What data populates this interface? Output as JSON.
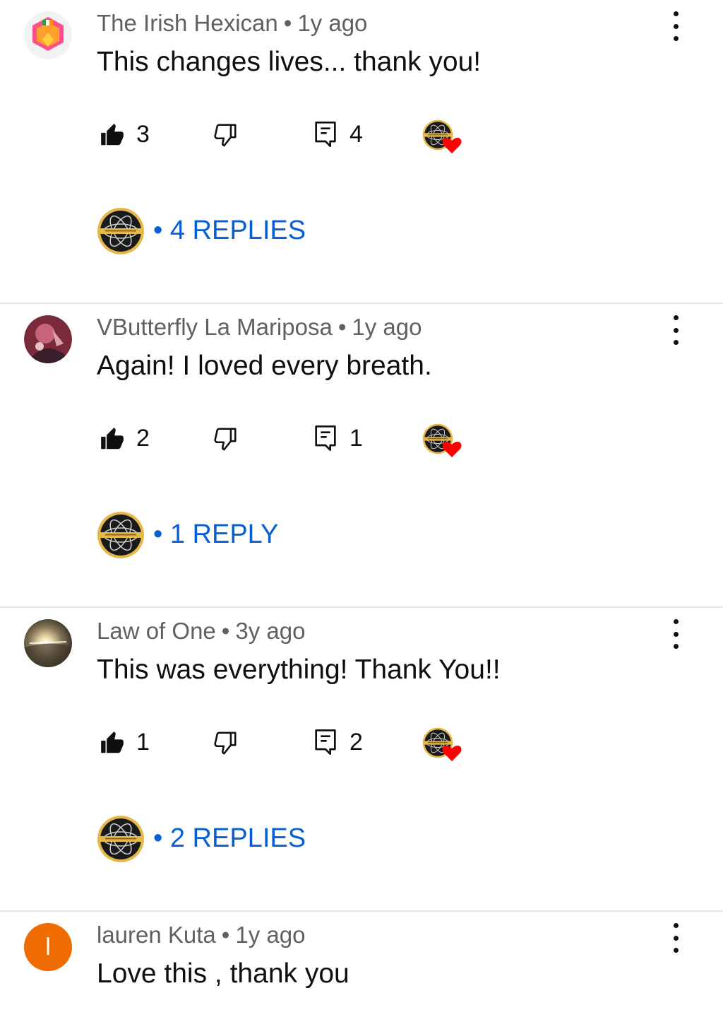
{
  "icons": {
    "like": "thumbs-up-icon",
    "dislike": "thumbs-down-icon",
    "reply": "comment-reply-icon",
    "menu": "more-vert-icon",
    "heart": "creator-heart-icon"
  },
  "colors": {
    "link": "#065fd4",
    "meta": "#606060",
    "heart": "#ff0000",
    "letter_avatar": "#ef6c00"
  },
  "separator": "•",
  "comments": [
    {
      "author": "The Irish Hexican",
      "time": "1y ago",
      "text": "This changes lives... thank you!",
      "likes": "3",
      "replies_count": "4",
      "replies_label": "• 4 REPLIES"
    },
    {
      "author": "VButterfly La Mariposa",
      "time": "1y ago",
      "text": "Again! I loved every breath.",
      "likes": "2",
      "replies_count": "1",
      "replies_label": "• 1 REPLY"
    },
    {
      "author": "Law of One",
      "time": "3y ago",
      "text": "This was everything! Thank You!!",
      "likes": "1",
      "replies_count": "2",
      "replies_label": "• 2 REPLIES"
    },
    {
      "author": "lauren Kuta",
      "time": "1y ago",
      "text": "Love this , thank you",
      "avatar_letter": "l"
    }
  ]
}
